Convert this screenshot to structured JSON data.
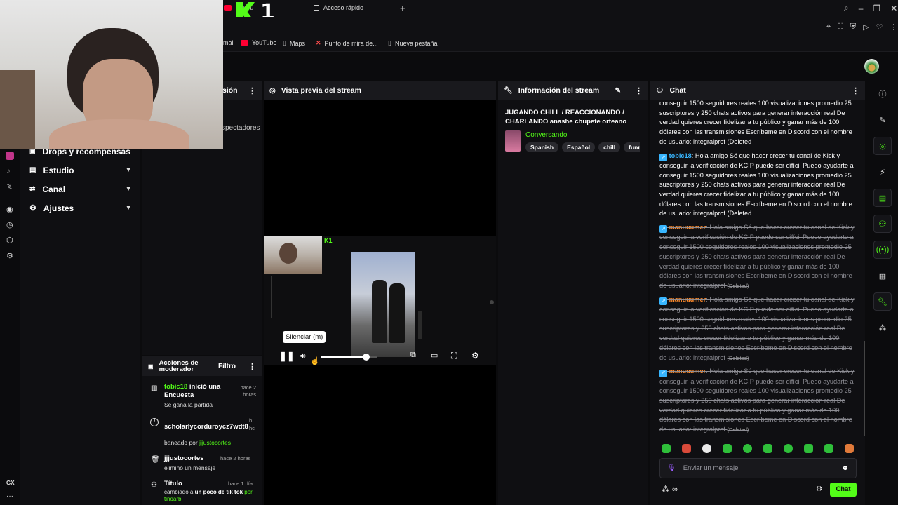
{
  "browser": {
    "tabs": [
      {
        "label": "YouTu"
      },
      {
        "label": "Acceso rápido"
      }
    ],
    "bookmarks": [
      {
        "label": "mail"
      },
      {
        "label": "YouTube"
      },
      {
        "label": "Maps"
      },
      {
        "label": "Punto de mira de..."
      },
      {
        "label": "Nueva pestaña"
      }
    ],
    "sidebar_label": "GX"
  },
  "nav": {
    "items": [
      {
        "label": "Drops y recompensas"
      },
      {
        "label": "Estudio"
      },
      {
        "label": "Canal"
      },
      {
        "label": "Ajustes"
      }
    ]
  },
  "partial_panel": {
    "title": "sión",
    "spectators": "spectadores"
  },
  "preview": {
    "title": "Vista previa del stream",
    "tooltip": "Silenciar (m)",
    "volume": 0.8
  },
  "stream_info": {
    "title": "Información del stream",
    "stream_title": "JUGANDO CHILL / REACCIONANDO / CHARLANDO anashe chupete orteano",
    "category": "Conversando",
    "tags": [
      "Spanish",
      "Español",
      "chill",
      "funny"
    ]
  },
  "mod": {
    "title": "Acciones de moderador",
    "filter": "Filtro",
    "entries": [
      {
        "user": "tobic18",
        "action": "inició una Encuesta",
        "time": "hace 2 horas",
        "detail": "Se gana la partida"
      },
      {
        "user": "scholarlycorduroycz7wdt8",
        "action": "",
        "time": "h hc",
        "detail_prefix": "baneado por ",
        "detail_user": "jjjustocortes"
      },
      {
        "user": "jjjustocortes",
        "action": "",
        "time": "hace 2 horas",
        "detail": "eliminó un mensaje"
      },
      {
        "user": "Título",
        "action": "",
        "time": "hace 1 día",
        "detail_prefix": "cambiado a ",
        "detail_bold": "un poco de tik tok",
        "detail_more": "por tinoarbl"
      }
    ]
  },
  "chat": {
    "title": "Chat",
    "spam": "Hola amigo Sé que hacer crecer tu canal de Kick y conseguir la verificación de KCIP puede ser difícil Puedo ayudarte a conseguir 1500 seguidores reales 100 visualizaciones promedio 25 suscriptores y 250 chats activos para generar interacción real De verdad quieres crecer fidelizar a tu público y ganar más de 100 dólares con las transmisiones Escríbeme en Discord con el nombre de usuario: integralprof",
    "first_fragment": "conseguir 1500 seguidores reales 100 visualizaciones promedio 25 suscriptores y 250 chats activos para generar interacción real De verdad quieres crecer fidelizar a tu público y ganar más de 100 dólares con las transmisiones Escríbeme en Discord con el nombre de usuario: integralprof",
    "deleted": "(Deleted",
    "deleted_label": "(Deleted)",
    "user1": "tobic18",
    "user2": "manuuumer",
    "input_placeholder": "Enviar un mensaje",
    "send": "Chat",
    "colors": {
      "accent": "#53fc18",
      "user_blue": "#38b6ff",
      "user_orange": "#ff8a2a"
    }
  }
}
